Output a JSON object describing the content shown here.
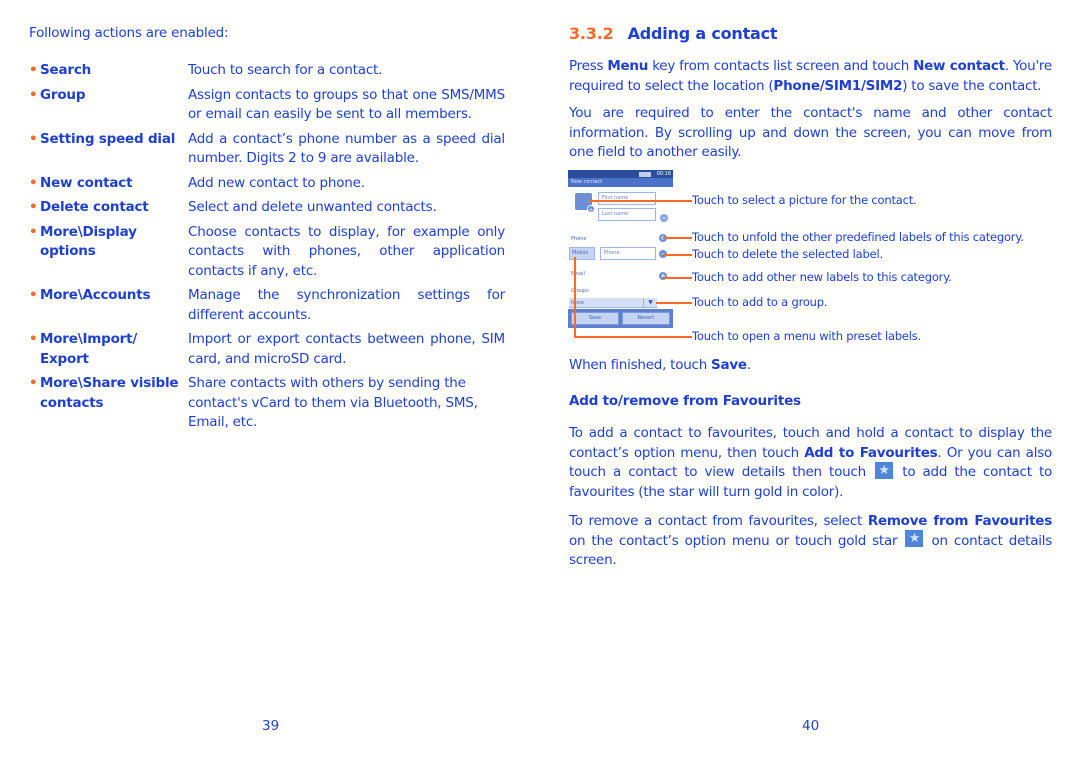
{
  "left_page": {
    "intro": "Following actions are enabled:",
    "actions": [
      {
        "term": "Search",
        "desc": "Touch to search for a contact."
      },
      {
        "term": "Group",
        "desc": "Assign contacts to groups so that one SMS/MMS or email can easily be sent to all members."
      },
      {
        "term": "Setting speed dial",
        "desc": "Add a contact’s phone number as a speed dial number.  Digits 2 to 9 are available."
      },
      {
        "term": "New contact",
        "desc": "Add new contact to phone."
      },
      {
        "term": "Delete contact",
        "desc": "Select and delete unwanted contacts."
      },
      {
        "term": "More\\Display options",
        "desc": "Choose contacts to display, for example only contacts with phones, other application contacts if any, etc."
      },
      {
        "term": "More\\Accounts",
        "desc": "Manage the synchronization settings for different accounts."
      },
      {
        "term": "More\\Import/ Export",
        "desc": "Import or export contacts between phone, SIM card, and microSD card."
      },
      {
        "term": "More\\Share visible contacts",
        "desc": "Share contacts with others by sending the contact's vCard to them via Bluetooth, SMS, Email, etc."
      }
    ],
    "page_number": "39"
  },
  "right_page": {
    "heading_number": "3.3.2",
    "heading_title": "Adding a contact",
    "para1": {
      "t1": "Press ",
      "b1": "Menu",
      "t2": " key from contacts list screen and touch ",
      "b2": "New contact",
      "t3": ". You're required to select the location (",
      "b3": "Phone/SIM1/SIM2",
      "t4": ") to save the contact."
    },
    "para2": "You are required to enter the contact's name and other contact information. By scrolling up and down the screen, you can move from one field to another easily.",
    "phone_screen": {
      "time": "00:18",
      "title": "New contact",
      "first_name_placeholder": "First name",
      "last_name_placeholder": "Last name",
      "phone_label": "Phone",
      "mobile_label": "Mobile",
      "phone_placeholder": "Phone",
      "email_label": "Email",
      "groups_label": "Groups",
      "group_value": "None",
      "save_button": "Save",
      "revert_button": "Revert"
    },
    "callouts": [
      "Touch to select a picture for the contact.",
      "Touch to unfold the other predefined labels of this category.",
      "Touch to delete the selected label.",
      "Touch to add other new labels to this category.",
      "Touch to add to a group.",
      "Touch to open a menu with preset labels."
    ],
    "finished": {
      "t1": "When finished, touch ",
      "b1": "Save",
      "t2": "."
    },
    "subheading": "Add to/remove from Favourites",
    "para3": {
      "t1": "To add a contact to favourites, touch and hold a contact to display the contact’s option menu, then touch ",
      "b1": "Add to Favourites",
      "t2": ". Or you can also touch a contact to view details then touch ",
      "t3": " to add the contact to favourites (the star will turn gold in color)."
    },
    "para4": {
      "t1": "To remove a contact from favourites, select ",
      "b1": "Remove from Favourites",
      "t2": " on the contact’s option menu or touch gold star ",
      "t3": " on contact details screen."
    },
    "page_number": "40"
  },
  "colors": {
    "text": "#1f3fd0",
    "accent": "#ff6a2a"
  }
}
